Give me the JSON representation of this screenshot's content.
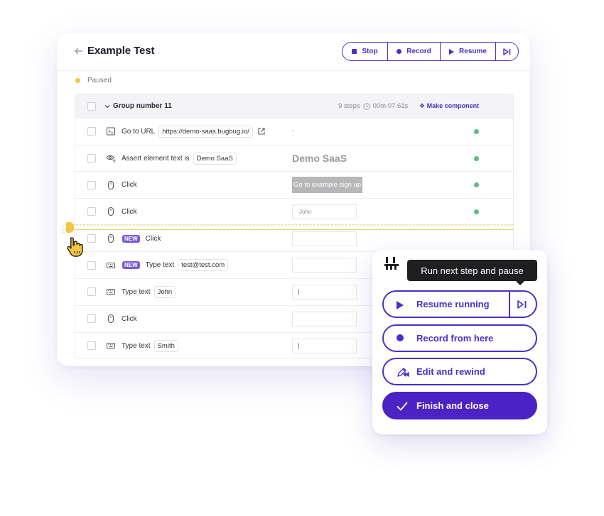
{
  "header": {
    "title": "Example Test",
    "controls": {
      "stop_label": "Stop",
      "record_label": "Record",
      "resume_label": "Resume"
    }
  },
  "status": {
    "label": "Paused",
    "color": "#f2c744"
  },
  "group": {
    "name": "Group number 11",
    "steps_count": "9 steps",
    "duration": "00m 07.61s",
    "make_component_label": "Make component"
  },
  "steps": [
    {
      "icon": "terminal-icon",
      "label": "Go to URL",
      "chip": "https://demo-saas.bugbug.io/",
      "preview": "-",
      "status": "passed"
    },
    {
      "icon": "eye-text-icon",
      "label": "Assert element text is",
      "chip": "Demo SaaS",
      "preview": "Demo SaaS",
      "status": "passed"
    },
    {
      "icon": "mouse-icon",
      "label": "Click",
      "preview": "Go to example sign up",
      "status": "passed"
    },
    {
      "icon": "mouse-icon",
      "label": "Click",
      "preview": "John",
      "status": "passed"
    },
    {
      "icon": "mouse-icon",
      "badge": "NEW",
      "label": "Click"
    },
    {
      "icon": "keyboard-icon",
      "badge": "NEW",
      "label": "Type text",
      "chip": "test@test.com"
    },
    {
      "icon": "keyboard-icon",
      "label": "Type text",
      "chip": "John"
    },
    {
      "icon": "mouse-icon",
      "label": "Click"
    },
    {
      "icon": "keyboard-icon",
      "label": "Type text",
      "chip": "Smith"
    }
  ],
  "popup": {
    "tooltip": "Run next step and pause",
    "resume_running_label": "Resume running",
    "record_from_here_label": "Record from here",
    "edit_and_rewind_label": "Edit and rewind",
    "finish_and_close_label": "Finish and close"
  },
  "colors": {
    "accent": "#4b2fc7",
    "passed": "#63b98a",
    "paused": "#f2c744",
    "new_badge": "#7a5ad8"
  }
}
